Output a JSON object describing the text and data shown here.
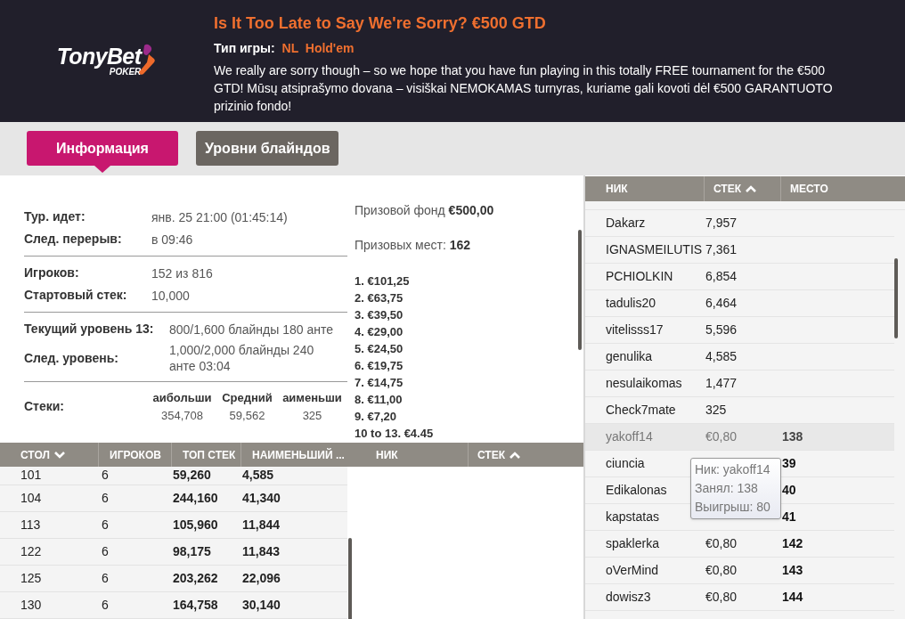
{
  "header": {
    "logo": {
      "brand": "TonyBet",
      "sub": "POKER"
    },
    "title": "Is It Too Late to Say We're Sorry? €500 GTD",
    "game_type_label": "Тип игры:",
    "game_type": "NL  Hold'em",
    "description": "We really are sorry though – so we hope that you have fun playing in this totally FREE tournament for the €500 GTD! Mūsų atsiprašymo dovana – visiškai NEMOKAMAS turnyras, kuriame gali kovoti dėl €500 GARANTUOTO prizinio fondo!"
  },
  "tabs": [
    {
      "label": "Информация",
      "selected": true
    },
    {
      "label": "Уровни блайндов",
      "selected": false
    }
  ],
  "info": {
    "groups": [
      [
        {
          "label": "Тур. идет:",
          "value": "янв. 25 21:00 (01:45:14)"
        },
        {
          "label": "След. перерыв:",
          "value": "в 09:46"
        }
      ],
      [
        {
          "label": "Игроков:",
          "value": "152 из 816"
        },
        {
          "label": "Стартовый стек:",
          "value": "10,000"
        }
      ],
      [
        {
          "label": "Текущий уровень 13:",
          "value": "800/1,600 блайнды 180 анте"
        },
        {
          "label": "След. уровень:",
          "value": "1,000/2,000 блайнды 240 анте 03:04"
        }
      ]
    ],
    "stacks": {
      "label": "Стеки:",
      "columns": [
        {
          "heading": "аибольши",
          "value": "354,708"
        },
        {
          "heading": "Средний",
          "value": "59,562"
        },
        {
          "heading": "аименьши",
          "value": "325"
        }
      ]
    }
  },
  "prizes": {
    "pool_label": "Призовой фонд",
    "pool": "€500,00",
    "places_label": "Призовых мест:",
    "places": "162",
    "payouts": [
      "1. €101,25",
      "2. €63,75",
      "3. €39,50",
      "4. €29,00",
      "5. €24,50",
      "6. €19,75",
      "7. €14,75",
      "8. €11,00",
      "9. €7,20",
      "10 to 13. €4.45"
    ]
  },
  "tables": {
    "columns": [
      {
        "label": "СТОЛ",
        "sorted": true,
        "ascending": false
      },
      {
        "label": "ИГРОКОВ"
      },
      {
        "label": "ТОП СТЕК"
      },
      {
        "label": "НАИМЕНЬШИЙ ..."
      }
    ],
    "rows": [
      [
        "101",
        "6",
        "59,260",
        "4,585"
      ],
      [
        "104",
        "6",
        "244,160",
        "41,340"
      ],
      [
        "113",
        "6",
        "105,960",
        "11,844"
      ],
      [
        "122",
        "6",
        "98,175",
        "11,843"
      ],
      [
        "125",
        "6",
        "203,262",
        "22,096"
      ],
      [
        "130",
        "6",
        "164,758",
        "30,140"
      ]
    ]
  },
  "table_players": {
    "columns": [
      {
        "label": "НИК"
      },
      {
        "label": "СТЕК",
        "sorted": true,
        "ascending": true
      }
    ]
  },
  "players": {
    "columns": [
      {
        "label": "НИК"
      },
      {
        "label": "СТЕК",
        "sorted": true,
        "ascending": true
      },
      {
        "label": "МЕСТО"
      }
    ],
    "rows": [
      {
        "nick": "Dakarz",
        "stack": "7,957",
        "selected": false
      },
      {
        "nick": "IGNASMEILUTIS",
        "stack": "7,361",
        "selected": false
      },
      {
        "nick": "PCHIOLKIN",
        "stack": "6,854",
        "selected": false
      },
      {
        "nick": "tadulis20",
        "stack": "6,464",
        "selected": false
      },
      {
        "nick": "vitelisss17",
        "stack": "5,596",
        "selected": false
      },
      {
        "nick": "genulika",
        "stack": "4,585",
        "selected": false
      },
      {
        "nick": "nesulaikomas",
        "stack": "1,477",
        "selected": false
      },
      {
        "nick": "Check7mate",
        "stack": "325",
        "selected": false
      },
      {
        "nick": "yakoff14",
        "stack": "€0,80",
        "place": "138",
        "selected": true
      },
      {
        "nick": "ciuncia",
        "place": "39",
        "selected": false
      },
      {
        "nick": "Edikalonas",
        "place": "40",
        "selected": false
      },
      {
        "nick": "kapstatas",
        "place": "41",
        "selected": false
      },
      {
        "nick": "spaklerka",
        "stack": "€0,80",
        "place": "142",
        "selected": false
      },
      {
        "nick": "oVerMind",
        "stack": "€0,80",
        "place": "143",
        "selected": false
      },
      {
        "nick": "dowisz3",
        "stack": "€0,80",
        "place": "144",
        "selected": false
      }
    ]
  },
  "tooltip": {
    "lines": [
      "Ник: yakoff14",
      "Занял: 138",
      "Выигрыш: 80"
    ]
  }
}
